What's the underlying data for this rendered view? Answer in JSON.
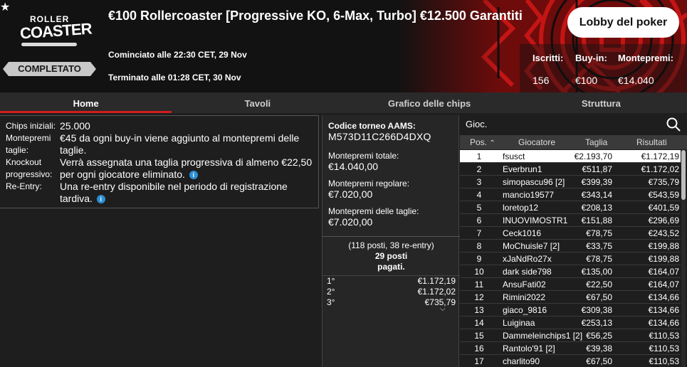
{
  "header": {
    "logo_top": "ROLLER",
    "logo_main": "COASTER",
    "status": "COMPLETATO",
    "title": "€100 Rollercoaster [Progressive KO, 6-Max, Turbo] €12.500 Garantiti",
    "started": "Cominciato alle 22:30 CET, 29 Nov",
    "ended": "Terminato alle 01:28 CET, 30 Nov",
    "lobby_button": "Lobby del poker",
    "stats": [
      {
        "label": "Iscritti:",
        "value": "156"
      },
      {
        "label": "Buy-in:",
        "value": "€100"
      },
      {
        "label": "Montepremi:",
        "value": "€14.040"
      }
    ],
    "accent_color": "#d31c1c"
  },
  "tabs": [
    {
      "label": "Home",
      "active": true
    },
    {
      "label": "Tavoli",
      "active": false
    },
    {
      "label": "Grafico delle chips",
      "active": false
    },
    {
      "label": "Struttura",
      "active": false
    }
  ],
  "info": {
    "chips_label": "Chips iniziali:",
    "chips_value": "25.000",
    "bounty_label": "Montepremi taglie:",
    "bounty_value": "€45 da ogni buy-in viene aggiunto al montepremi delle taglie.",
    "ko_label": "Knockout progressivo:",
    "ko_value": "Verrà assegnata una taglia progressiva di almeno €22,50 per ogni giocatore eliminato.",
    "reentry_label": "Re-Entry:",
    "reentry_value": "Una re-entry disponibile nel periodo di registrazione tardiva."
  },
  "prize": {
    "aams_label": "Codice torneo AAMS:",
    "aams_code": "M573D11C266D4DXQ",
    "total_label": "Montepremi totale:",
    "total_value": "€14.040,00",
    "regular_label": "Montepremi regolare:",
    "regular_value": "€7.020,00",
    "bounty_label": "Montepremi delle taglie:",
    "bounty_value": "€7.020,00",
    "entries": "(118 posti, 38 re-entry)",
    "paid_line1": "29 posti",
    "paid_line2": "pagati.",
    "places": [
      {
        "place": "1°",
        "amount": "€1.172,19"
      },
      {
        "place": "2°",
        "amount": "€1.172,02"
      },
      {
        "place": "3°",
        "amount": "€735,79"
      }
    ]
  },
  "players": {
    "search_placeholder": "Gioc.",
    "columns": {
      "pos": "Pos.",
      "player": "Giocatore",
      "bounty": "Taglia",
      "result": "Risultati"
    },
    "rows": [
      {
        "pos": "1",
        "name": "fsusct",
        "bounty": "€2.193,70",
        "result": "€1.172,19"
      },
      {
        "pos": "2",
        "name": "Everbrun1",
        "bounty": "€511,87",
        "result": "€1.172,02"
      },
      {
        "pos": "3",
        "name": "simopascu96 [2]",
        "bounty": "€399,39",
        "result": "€735,79"
      },
      {
        "pos": "4",
        "name": "mancio19577",
        "bounty": "€343,14",
        "result": "€543,59"
      },
      {
        "pos": "5",
        "name": "loretop12",
        "bounty": "€208,13",
        "result": "€401,59"
      },
      {
        "pos": "6",
        "name": "INUOVIMOSTR1",
        "bounty": "€151,88",
        "result": "€296,69"
      },
      {
        "pos": "7",
        "name": "Ceck1016",
        "bounty": "€78,75",
        "result": "€243,52"
      },
      {
        "pos": "8",
        "name": "MoChuisle7 [2]",
        "bounty": "€33,75",
        "result": "€199,88"
      },
      {
        "pos": "9",
        "name": "xJaNdRo27x",
        "bounty": "€78,75",
        "result": "€199,88"
      },
      {
        "pos": "10",
        "name": "dark side798",
        "bounty": "€135,00",
        "result": "€164,07"
      },
      {
        "pos": "11",
        "name": "AnsuFati02",
        "bounty": "€22,50",
        "result": "€164,07"
      },
      {
        "pos": "12",
        "name": "Rimini2022",
        "bounty": "€67,50",
        "result": "€134,66"
      },
      {
        "pos": "13",
        "name": "giaco_9816",
        "bounty": "€309,38",
        "result": "€134,66"
      },
      {
        "pos": "14",
        "name": "Luiginaa",
        "bounty": "€253,13",
        "result": "€134,66"
      },
      {
        "pos": "15",
        "name": "Dammeleinchips1 [2]",
        "bounty": "€56,25",
        "result": "€110,53"
      },
      {
        "pos": "16",
        "name": "Rantolo'91 [2]",
        "bounty": "€39,38",
        "result": "€110,53"
      },
      {
        "pos": "17",
        "name": "charlito90",
        "bounty": "€67,50",
        "result": "€110,53"
      }
    ]
  }
}
